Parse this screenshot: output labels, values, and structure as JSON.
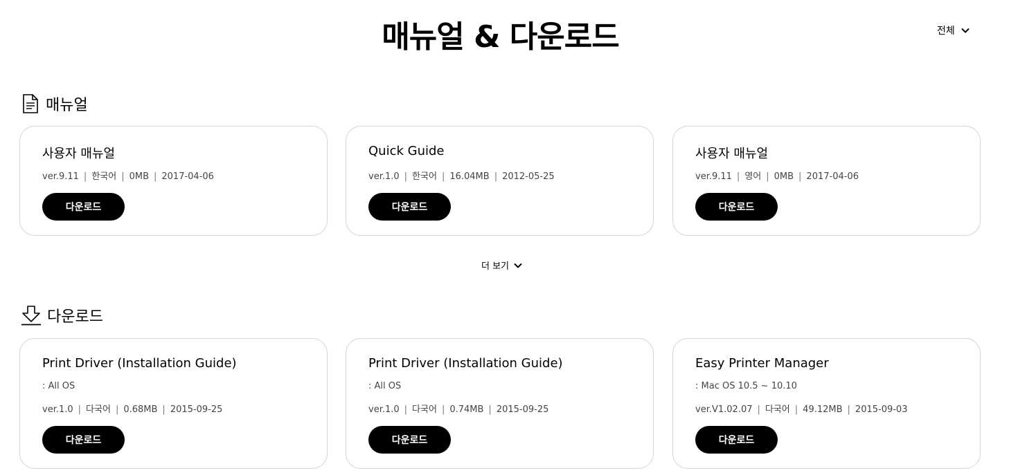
{
  "header": {
    "title": "매뉴얼 & 다운로드",
    "filter_label": "전체"
  },
  "manuals": {
    "section_title": "매뉴얼",
    "cards": [
      {
        "title": "사용자 매뉴얼",
        "version": "ver.9.11",
        "language": "한국어",
        "size": "0MB",
        "date": "2017-04-06",
        "button": "다운로드"
      },
      {
        "title": "Quick Guide",
        "version": "ver.1.0",
        "language": "한국어",
        "size": "16.04MB",
        "date": "2012-05-25",
        "button": "다운로드"
      },
      {
        "title": "사용자 매뉴얼",
        "version": "ver.9.11",
        "language": "영어",
        "size": "0MB",
        "date": "2017-04-06",
        "button": "다운로드"
      }
    ],
    "more_label": "더 보기"
  },
  "downloads": {
    "section_title": "다운로드",
    "cards": [
      {
        "title": "Print Driver (Installation Guide)",
        "os": ": All OS",
        "version": "ver.1.0",
        "language": "다국어",
        "size": "0.68MB",
        "date": "2015-09-25",
        "button": "다운로드"
      },
      {
        "title": "Print Driver (Installation Guide)",
        "os": ": All OS",
        "version": "ver.1.0",
        "language": "다국어",
        "size": "0.74MB",
        "date": "2015-09-25",
        "button": "다운로드"
      },
      {
        "title": "Easy Printer Manager",
        "os": ": Mac OS 10.5 ~ 10.10",
        "version": "ver.V1.02.07",
        "language": "다국어",
        "size": "49.12MB",
        "date": "2015-09-03",
        "button": "다운로드"
      }
    ]
  }
}
